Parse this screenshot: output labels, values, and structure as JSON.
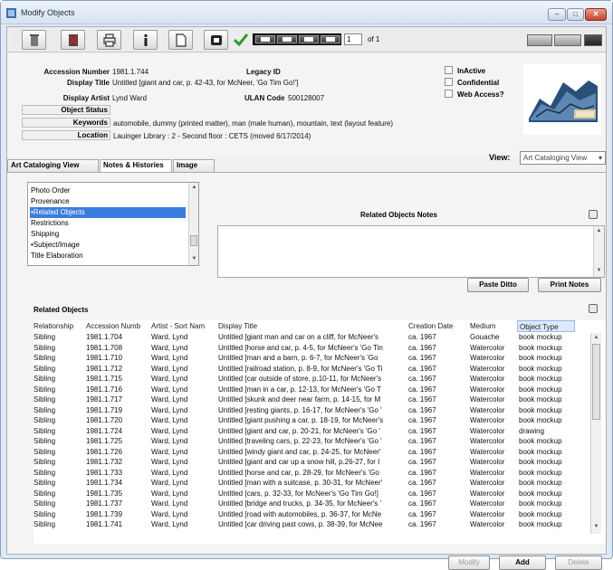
{
  "window": {
    "title": "Modify Objects"
  },
  "toolbar": {
    "page_value": "1",
    "page_of": "of 1"
  },
  "record": {
    "accession_label": "Accession Number",
    "accession_value": "1981.1.744",
    "legacy_label": "Legacy ID",
    "display_title_label": "Display Title",
    "display_title_value": "Untitled [giant and car, p. 42-43, for McNeer, 'Go Tim Go!']",
    "display_artist_label": "Display Artist",
    "display_artist_value": "Lynd Ward",
    "ulan_label": "ULAN Code",
    "ulan_value": "500128007",
    "object_status_label": "Object Status",
    "keywords_label": "Keywords",
    "keywords_value": "automobile, dummy (printed matter), man (male human), mountain, text (layout feature)",
    "location_label": "Location",
    "location_value": "Lauinger Library : 2 - Second floor : CETS (moved 6/17/2014)",
    "checkboxes": [
      {
        "label": "InActive",
        "checked": false
      },
      {
        "label": "Confidential",
        "checked": false
      },
      {
        "label": "Web Access?",
        "checked": false
      }
    ]
  },
  "tabs": [
    {
      "label": "Art Cataloging View",
      "active": false
    },
    {
      "label": "Notes & Histories",
      "active": true
    },
    {
      "label": "Image List",
      "active": false
    }
  ],
  "view": {
    "label": "View:",
    "selected": "Art Cataloging View"
  },
  "notes_list": {
    "items": [
      {
        "label": "Photo Order",
        "selected": false
      },
      {
        "label": "Provenance",
        "selected": false
      },
      {
        "label": "•Related Objects",
        "selected": true
      },
      {
        "label": "Restrictions",
        "selected": false
      },
      {
        "label": "Shipping",
        "selected": false
      },
      {
        "label": "•Subject/Image",
        "selected": false
      },
      {
        "label": "Title Elaboration",
        "selected": false
      }
    ]
  },
  "related_notes": {
    "title": "Related Objects Notes",
    "paste_label": "Paste Ditto",
    "print_label": "Print Notes"
  },
  "related_objects": {
    "title": "Related Objects",
    "columns": [
      "Relationship",
      "Accession Numb",
      "Artist - Sort Nam",
      "Display Title",
      "Creation Date",
      "Medium",
      "Object Type"
    ],
    "rows": [
      [
        "Sibling",
        "1981.1.704",
        "Ward, Lynd",
        "Untitled [giant man and car on a cliff, for McNeer's",
        "ca. 1967",
        "Gouache",
        "book mockup"
      ],
      [
        "Sibling",
        "1981.1.708",
        "Ward, Lynd",
        "Untitled [horse and car, p. 4-5, for McNeer's 'Go Tin",
        "ca. 1967",
        "Watercolor",
        "book mockup"
      ],
      [
        "Sibling",
        "1981.1.710",
        "Ward, Lynd",
        "Untitled [man and a barn, p. 6-7, for McNeer's 'Go",
        "ca. 1967",
        "Watercolor",
        "book mockup"
      ],
      [
        "Sibling",
        "1981.1.712",
        "Ward, Lynd",
        "Untitled [railroad station, p. 8-9, for McNeer's 'Go Ti",
        "ca. 1967",
        "Watercolor",
        "book mockup"
      ],
      [
        "Sibling",
        "1981.1.715",
        "Ward, Lynd",
        "Untitled [car outside of store, p.10-11, for McNeer's",
        "ca. 1967",
        "Watercolor",
        "book mockup"
      ],
      [
        "Sibling",
        "1981.1.716",
        "Ward, Lynd",
        "Untitled [man in a car, p. 12-13, for McNeer's 'Go T",
        "ca. 1967",
        "Watercolor",
        "book mockup"
      ],
      [
        "Sibling",
        "1981.1.717",
        "Ward, Lynd",
        "Untitled [skunk and deer near farm, p. 14-15, for M",
        "ca. 1967",
        "Watercolor",
        "book mockup"
      ],
      [
        "Sibling",
        "1981.1.719",
        "Ward, Lynd",
        "Untitled [resting giants, p. 16-17, for McNeer's 'Go '",
        "ca. 1967",
        "Watercolor",
        "book mockup"
      ],
      [
        "Sibling",
        "1981.1.720",
        "Ward, Lynd",
        "Untitled [giant pushing a car, p. 18-19, for McNeer's",
        "ca. 1967",
        "Watercolor",
        "book mockup"
      ],
      [
        "Sibling",
        "1981.1.724",
        "Ward, Lynd",
        "Untitled [giant and car, p. 20-21, for McNeer's 'Go '",
        "ca. 1967",
        "Watercolor",
        "drawing"
      ],
      [
        "Sibling",
        "1981.1.725",
        "Ward, Lynd",
        "Untitled [traveling cars, p. 22-23, for McNeer's 'Go '",
        "ca. 1967",
        "Watercolor",
        "book mockup"
      ],
      [
        "Sibling",
        "1981.1.726",
        "Ward, Lynd",
        "Untitled [windy giant and car, p. 24-25, for McNeer'",
        "ca. 1967",
        "Watercolor",
        "book mockup"
      ],
      [
        "Sibling",
        "1981.1.732",
        "Ward, Lynd",
        "Untitled [giant and car up a snow hill, p.26-27, for I",
        "ca. 1967",
        "Watercolor",
        "book mockup"
      ],
      [
        "Sibling",
        "1981.1.733",
        "Ward, Lynd",
        "Untitled [horse and car, p. 28-29, for McNeer's 'Go",
        "ca. 1967",
        "Watercolor",
        "book mockup"
      ],
      [
        "Sibling",
        "1981.1.734",
        "Ward, Lynd",
        "Untitled [man with a suitcase, p. 30-31, for McNeer'",
        "ca. 1967",
        "Watercolor",
        "book mockup"
      ],
      [
        "Sibling",
        "1981.1.735",
        "Ward, Lynd",
        "Untitled [cars, p. 32-33, for McNeer's 'Go Tim Go!]",
        "ca. 1967",
        "Watercolor",
        "book mockup"
      ],
      [
        "Sibling",
        "1981.1.737",
        "Ward, Lynd",
        "Untitled [bridge and trucks, p. 34-35, for McNeer's '",
        "ca. 1967",
        "Watercolor",
        "book mockup"
      ],
      [
        "Sibling",
        "1981.1.739",
        "Ward, Lynd",
        "Untitled [road with automobiles, p. 36-37, for McNe",
        "ca. 1967",
        "Watercolor",
        "book mockup"
      ],
      [
        "Sibling",
        "1981.1.741",
        "Ward, Lynd",
        "Untitled [car driving past cows, p. 38-39, for McNee",
        "ca. 1967",
        "Watercolor",
        "book mockup"
      ]
    ],
    "modify_label": "Modify",
    "add_label": "Add",
    "delete_label": "Delete"
  },
  "colors": {
    "selection": "#3b7ddd",
    "checkmark": "#2e9b2e",
    "toolbar_red": "#c22222"
  }
}
